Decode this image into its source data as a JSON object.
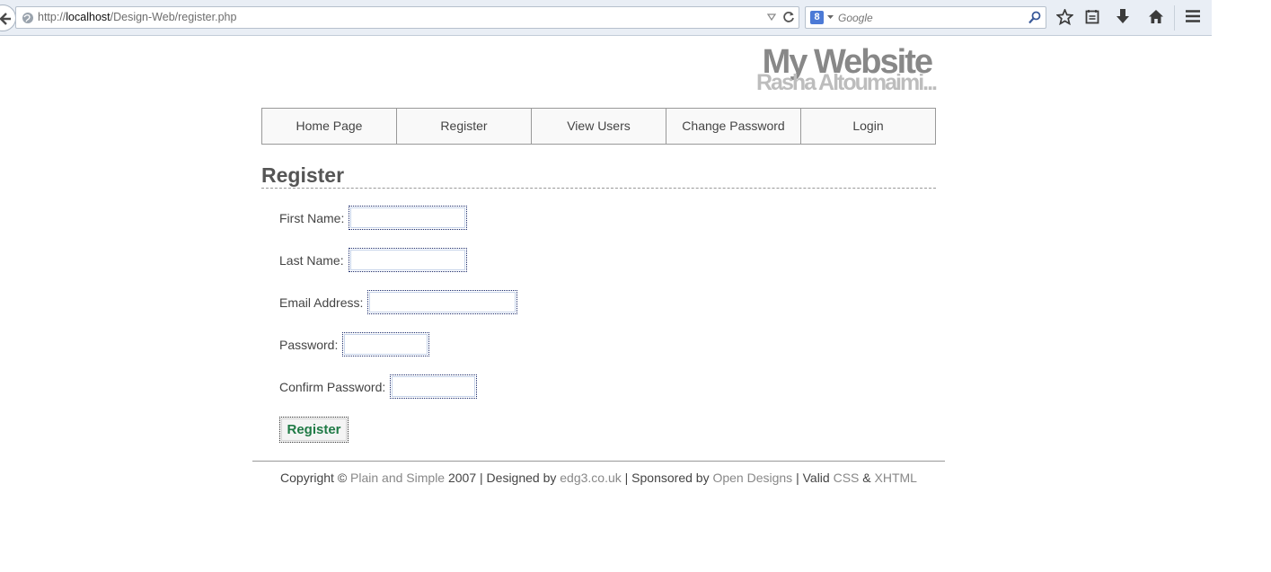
{
  "browser": {
    "url_prefix": "http://",
    "url_host": "localhost",
    "url_path": "/Design-Web/register.php",
    "search_engine_glyph": "8",
    "search_placeholder": "Google",
    "icons": [
      "back-arrow-icon",
      "globe-icon",
      "dropdown-triangle-icon",
      "reload-icon",
      "search-icon",
      "bookmark-star-icon",
      "reading-list-icon",
      "download-icon",
      "home-icon",
      "menu-icon"
    ]
  },
  "site": {
    "title": "My Website",
    "subtitle": "Rasha Altoumaimi..."
  },
  "nav": {
    "items": [
      {
        "label": "Home Page"
      },
      {
        "label": "Register"
      },
      {
        "label": "View Users"
      },
      {
        "label": "Change Password"
      },
      {
        "label": "Login"
      }
    ]
  },
  "page": {
    "heading": "Register"
  },
  "form": {
    "first_name_label": "First Name:",
    "first_name_value": "",
    "last_name_label": "Last Name:",
    "last_name_value": "",
    "email_label": "Email Address:",
    "email_value": "",
    "password_label": "Password:",
    "password_value": "",
    "confirm_password_label": "Confirm Password:",
    "confirm_password_value": "",
    "submit_label": "Register"
  },
  "footer": {
    "copyright_prefix": "Copyright © ",
    "plain_simple_link": "Plain and Simple",
    "year_designed": " 2007 | Designed by ",
    "edg3_link": "edg3.co.uk",
    "sponsored": " | Sponsored by ",
    "open_designs_link": "Open Designs",
    "valid": " | Valid ",
    "css_link": "CSS",
    "amp": " & ",
    "xhtml_link": "XHTML"
  },
  "colors": {
    "submit_text": "#1f7a45",
    "link": "#888888",
    "title": "#888888",
    "subtitle": "#bdbdbd"
  }
}
